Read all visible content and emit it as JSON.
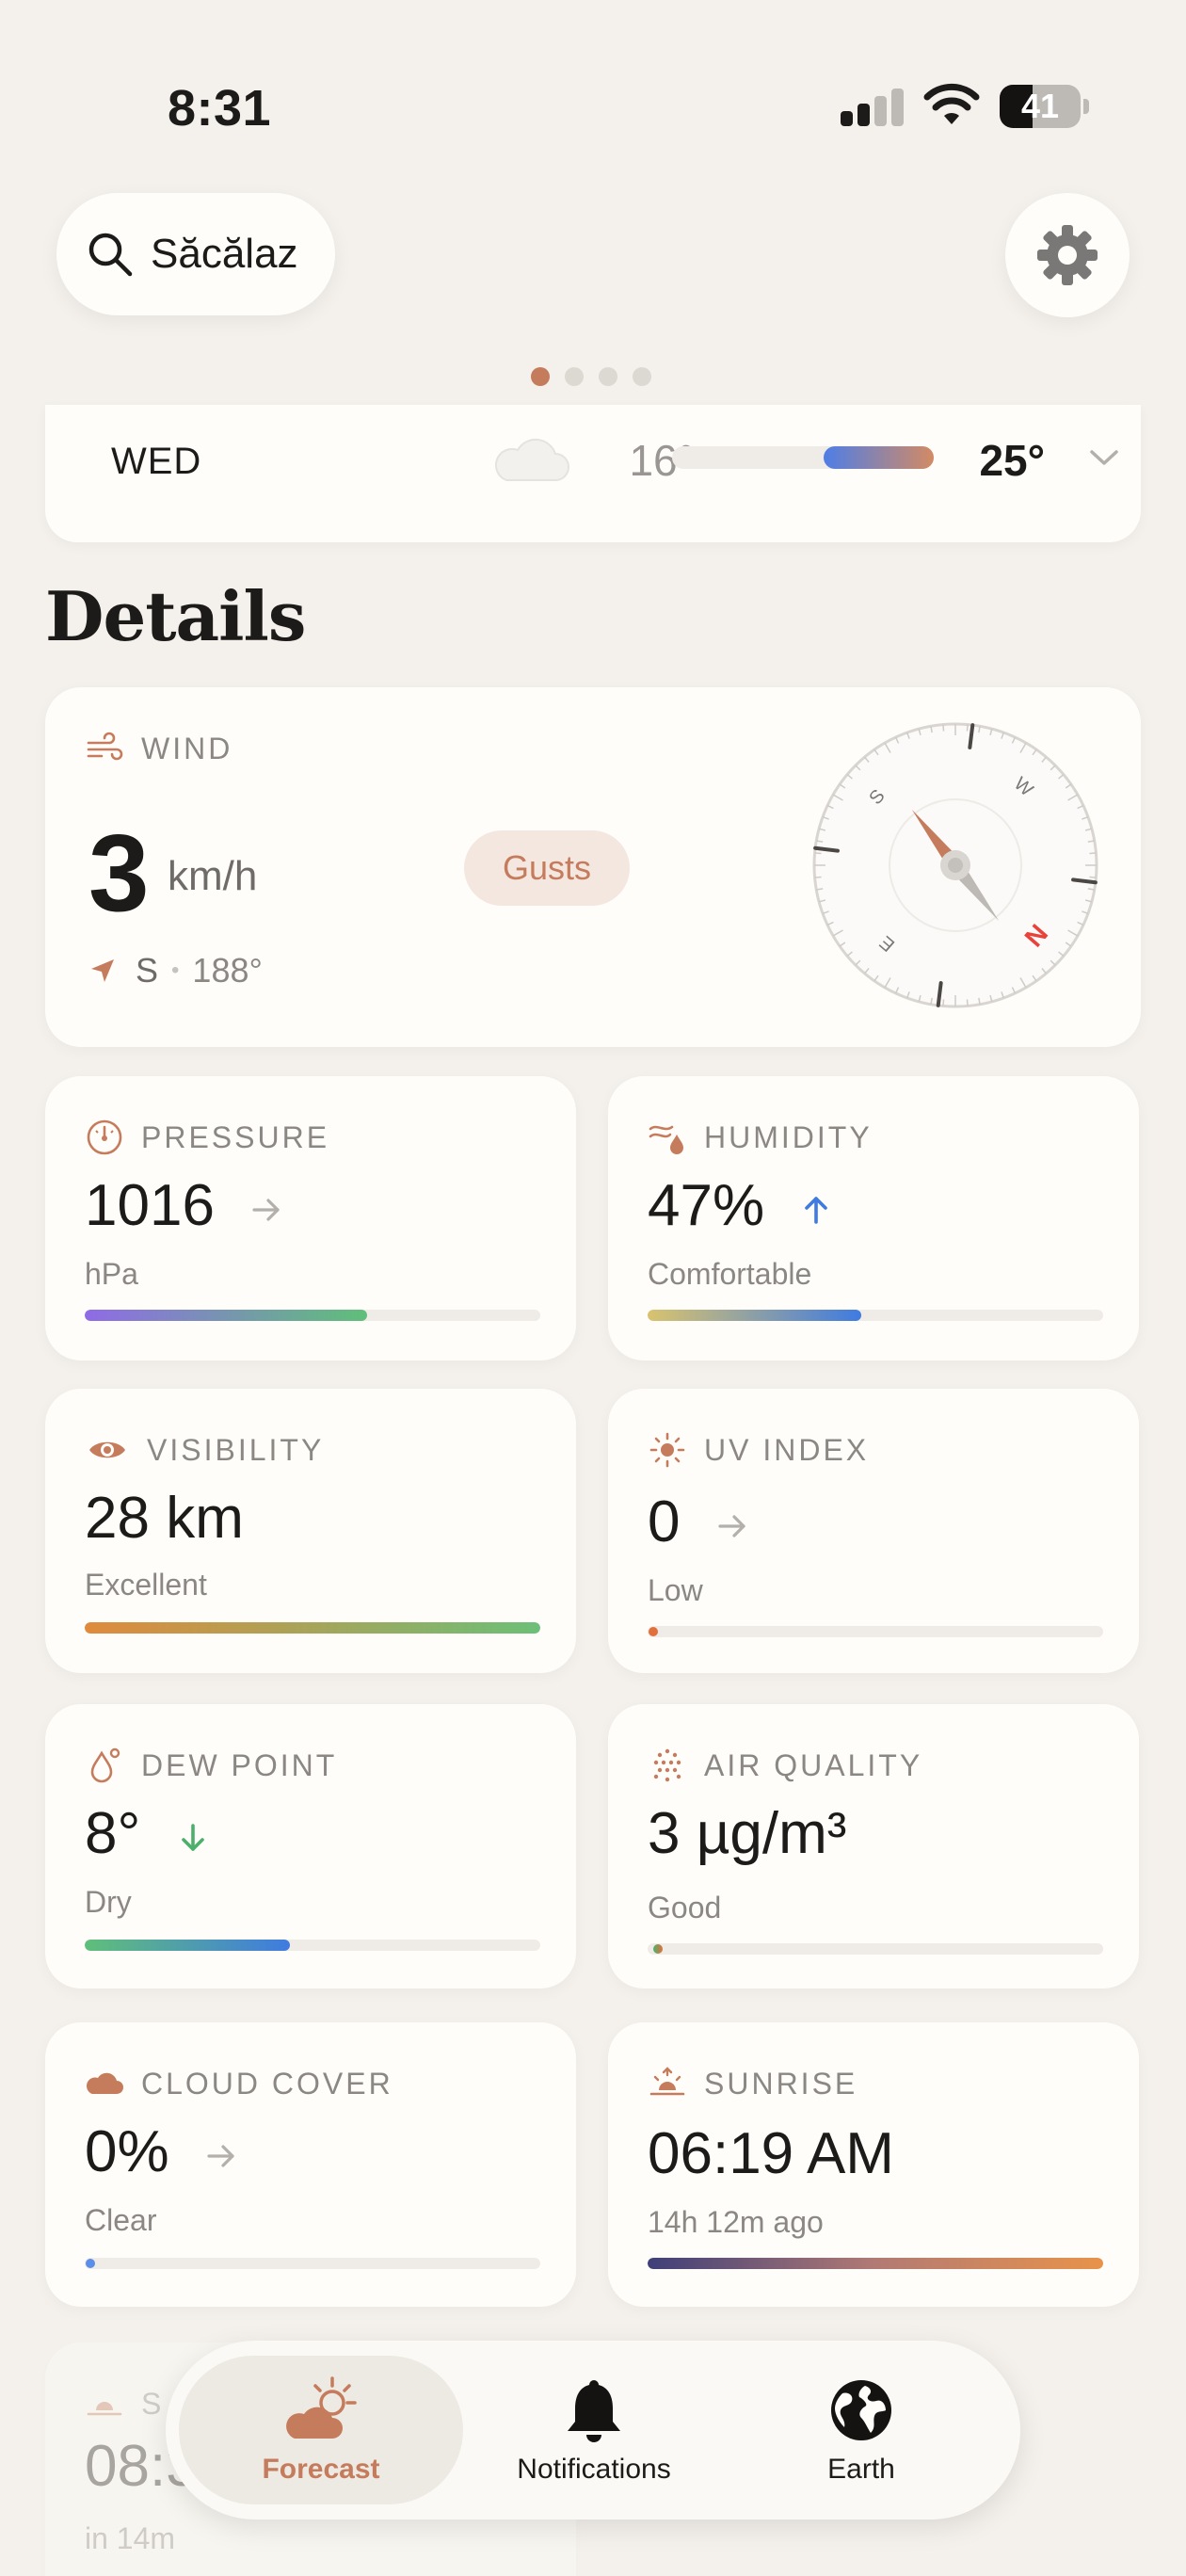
{
  "status_bar": {
    "time": "8:31",
    "battery": "41",
    "battery_level": 0.41
  },
  "header": {
    "location": "Săcălaz",
    "search_icon": "search-icon",
    "settings_icon": "gear-icon"
  },
  "pager": {
    "count": 4,
    "active": 0
  },
  "forecast_row": {
    "day": "WED",
    "icon": "cloud-icon",
    "low": "16°",
    "high": "25°",
    "range_start": 0.58,
    "range_end": 1.0
  },
  "details_title": "Details",
  "wind": {
    "label": "WIND",
    "speed": "3",
    "unit": "km/h",
    "gusts_label": "Gusts",
    "direction": "S",
    "degrees": "188°",
    "compass": {
      "S": "S",
      "W": "W",
      "E": "E",
      "N": "N"
    },
    "heading_deg": 188
  },
  "pressure": {
    "label": "PRESSURE",
    "value": "1016",
    "unit": "hPa",
    "trend": "steady",
    "level": 0.62
  },
  "humidity": {
    "label": "HUMIDITY",
    "value": "47%",
    "description": "Comfortable",
    "trend": "up",
    "level": 0.47
  },
  "visibility": {
    "label": "VISIBILITY",
    "value": "28 km",
    "description": "Excellent",
    "level": 1.0
  },
  "uv_index": {
    "label": "UV INDEX",
    "value": "0",
    "description": "Low",
    "trend": "steady",
    "level": 0.0
  },
  "dew_point": {
    "label": "DEW POINT",
    "value": "8°",
    "description": "Dry",
    "trend": "down",
    "level": 0.45
  },
  "air_quality": {
    "label": "AIR QUALITY",
    "value": "3 µg/m³",
    "description": "Good",
    "level": 0.01
  },
  "cloud_cover": {
    "label": "CLOUD COVER",
    "value": "0%",
    "description": "Clear",
    "trend": "steady",
    "level": 0.0
  },
  "sunrise": {
    "label": "SUNRISE",
    "value": "06:19 AM",
    "description": "14h 12m ago",
    "level": 1.0
  },
  "sunset_peek": {
    "label": "S",
    "value": "08:3",
    "description": "in 14m"
  },
  "nav": [
    {
      "label": "Forecast",
      "icon": "sun-cloud-icon",
      "active": true
    },
    {
      "label": "Notifications",
      "icon": "bell-icon",
      "active": false
    },
    {
      "label": "Earth",
      "icon": "globe-icon",
      "active": false
    }
  ],
  "colors": {
    "accent": "#c57c5c",
    "background": "#f4f1ec",
    "card": "#fffdfa",
    "up": "#3f7be0",
    "down": "#4cb06c",
    "compass_north": "#e8423a"
  }
}
